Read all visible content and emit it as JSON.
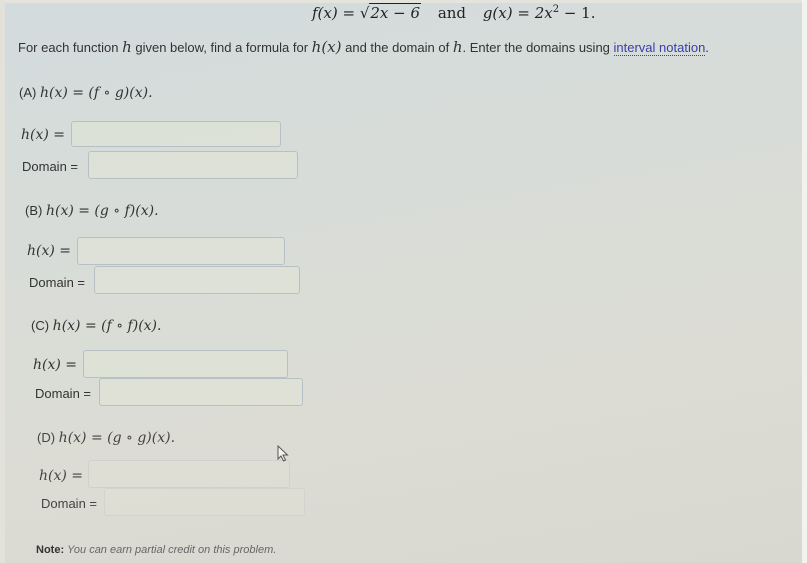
{
  "header": {
    "f_def_lhs": "f(x) = ",
    "f_def_radicand": "2x − 6",
    "connector": "and",
    "g_def": "g(x) = 2x",
    "g_exponent": "2",
    "g_tail": " − 1."
  },
  "intro": {
    "text_before_h": "For each function ",
    "h_symbol": "h",
    "text_after_h": " given below, find a formula for ",
    "hx_symbol": "h(x)",
    "text_middle": " and the domain of ",
    "h_symbol2": "h",
    "text_end": ". Enter the domains using ",
    "link_label": "interval notation",
    "period": "."
  },
  "parts": [
    {
      "label": "(A)",
      "formula": "h(x) = (f ∘ g)(x).",
      "hx_label": "h(x) =",
      "domain_label": "Domain =",
      "hx_value": "",
      "domain_value": ""
    },
    {
      "label": "(B)",
      "formula": "h(x) = (g ∘ f)(x).",
      "hx_label": "h(x) =",
      "domain_label": "Domain =",
      "hx_value": "",
      "domain_value": ""
    },
    {
      "label": "(C)",
      "formula": "h(x) = (f ∘ f)(x).",
      "hx_label": "h(x) =",
      "domain_label": "Domain =",
      "hx_value": "",
      "domain_value": ""
    },
    {
      "label": "(D)",
      "formula": "h(x) = (g ∘ g)(x).",
      "hx_label": "h(x) =",
      "domain_label": "Domain =",
      "hx_value": "",
      "domain_value": ""
    }
  ],
  "note": {
    "label": "Note:",
    "text": "You can earn partial credit on this problem."
  },
  "colors": {
    "link": "#3a3fa8",
    "input_border": "#b7c0c4"
  }
}
